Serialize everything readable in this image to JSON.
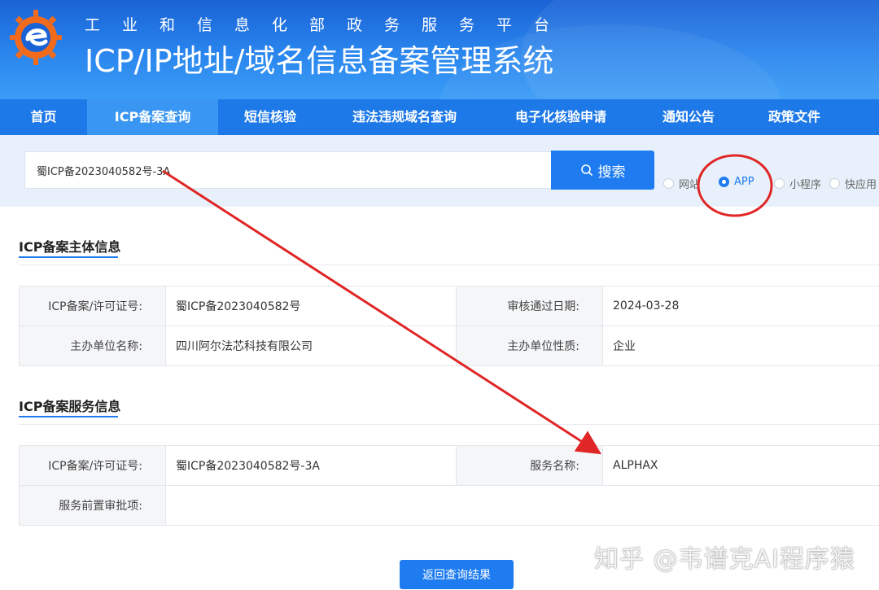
{
  "header": {
    "subtitle": "工业和信息化部政务服务平台",
    "title": "ICP/IP地址/域名信息备案管理系统"
  },
  "nav": {
    "items": [
      {
        "label": "首页"
      },
      {
        "label": "ICP备案查询",
        "active": true
      },
      {
        "label": "短信核验"
      },
      {
        "label": "违法违规域名查询"
      },
      {
        "label": "电子化核验申请"
      },
      {
        "label": "通知公告"
      },
      {
        "label": "政策文件"
      }
    ]
  },
  "search": {
    "value": "蜀ICP备2023040582号-3A",
    "button_label": "搜索",
    "types": [
      {
        "label": "网站",
        "checked": false
      },
      {
        "label": "APP",
        "checked": true
      },
      {
        "label": "小程序",
        "checked": false
      },
      {
        "label": "快应用",
        "checked": false
      }
    ]
  },
  "subject": {
    "title": "ICP备案主体信息",
    "rows": [
      [
        "ICP备案/许可证号:",
        "蜀ICP备2023040582号",
        "审核通过日期:",
        "2024-03-28"
      ],
      [
        "主办单位名称:",
        "四川阿尔法芯科技有限公司",
        "主办单位性质:",
        "企业"
      ]
    ]
  },
  "service": {
    "title": "ICP备案服务信息",
    "rows": [
      [
        "ICP备案/许可证号:",
        "蜀ICP备2023040582号-3A",
        "服务名称:",
        "ALPHAX"
      ],
      [
        "服务前置审批项:",
        ""
      ]
    ]
  },
  "back_button": "返回查询结果",
  "watermark": "知乎 @韦谱克AI程序猿",
  "colors": {
    "primary": "#1e7cf0",
    "nav": "#1e79e8",
    "annotation": "#e02626"
  }
}
